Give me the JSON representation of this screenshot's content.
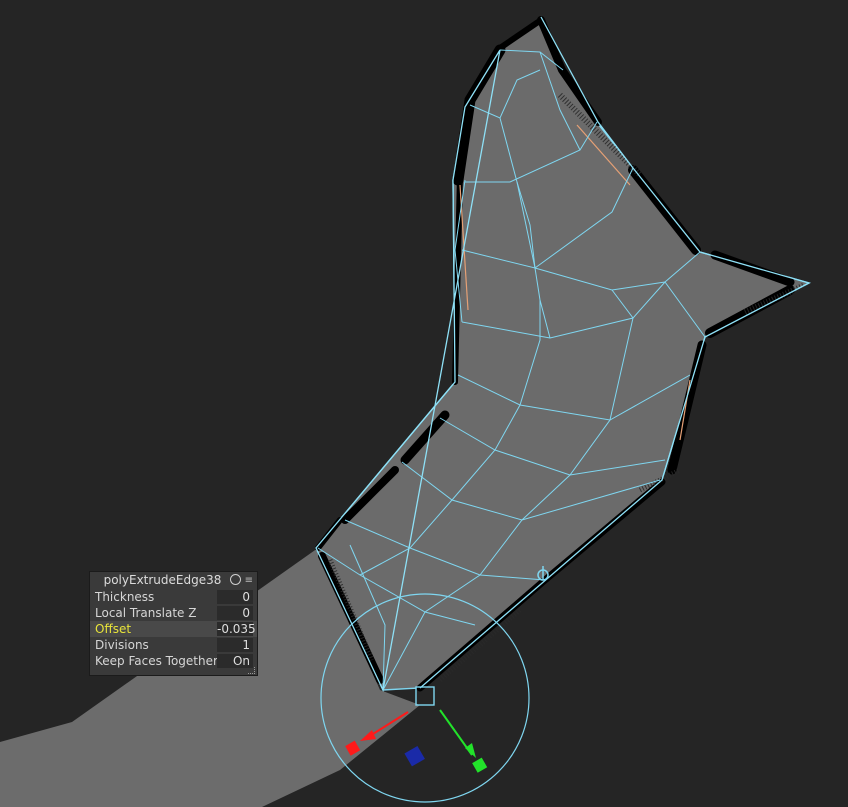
{
  "node_name": "polyExtrudeEdge38",
  "attributes": [
    {
      "label": "Thickness",
      "value": "0"
    },
    {
      "label": "Local Translate Z",
      "value": "0"
    },
    {
      "label": "Offset",
      "value": "-0.035",
      "highlighted": true
    },
    {
      "label": "Divisions",
      "value": "1"
    },
    {
      "label": "Keep Faces Together",
      "value": "On"
    }
  ],
  "icons": {
    "header_left": "attribute-editor-icon",
    "header_right": "options-menu-icon",
    "pivot": "pivot-handle-icon"
  },
  "colors": {
    "background": "#252525",
    "mesh_face": "#6b6b6b",
    "wireframe": "#7fd6f0",
    "border_edge": "#000000",
    "manipulator_x": "#ff1a1a",
    "manipulator_y": "#22e22a",
    "manipulator_z": "#1a2aa8",
    "highlight_label": "#e8e43a"
  }
}
